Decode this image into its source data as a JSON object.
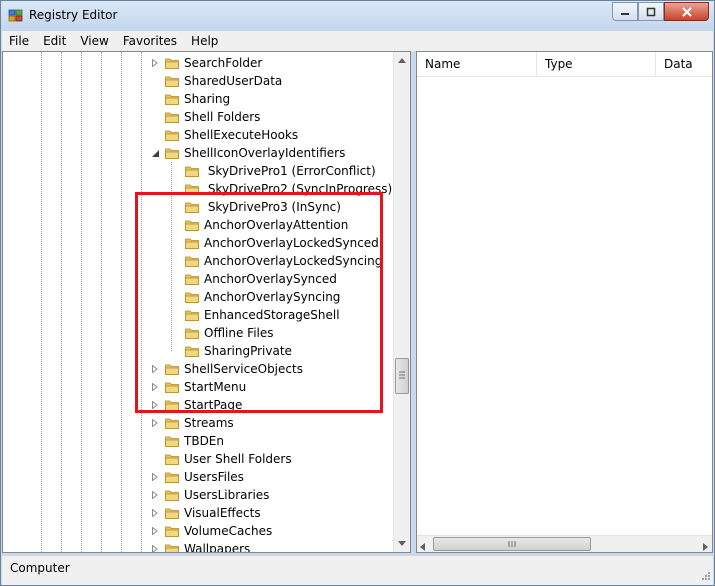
{
  "window": {
    "title": "Registry Editor",
    "app_icon": "registry-icon"
  },
  "menu": [
    "File",
    "Edit",
    "View",
    "Favorites",
    "Help"
  ],
  "tree": {
    "items": [
      {
        "label": "SearchFolder",
        "expander": "collapsed",
        "level": 0
      },
      {
        "label": "SharedUserData",
        "expander": "none",
        "level": 0
      },
      {
        "label": "Sharing",
        "expander": "none",
        "level": 0
      },
      {
        "label": "Shell Folders",
        "expander": "none",
        "level": 0
      },
      {
        "label": "ShellExecuteHooks",
        "expander": "none",
        "level": 0
      },
      {
        "label": "ShellIconOverlayIdentifiers",
        "expander": "expanded",
        "level": 0
      },
      {
        "label": " SkyDrivePro1 (ErrorConflict)",
        "expander": "none",
        "level": 1
      },
      {
        "label": " SkyDrivePro2 (SyncInProgress)",
        "expander": "none",
        "level": 1
      },
      {
        "label": " SkyDrivePro3 (InSync)",
        "expander": "none",
        "level": 1
      },
      {
        "label": "AnchorOverlayAttention",
        "expander": "none",
        "level": 1
      },
      {
        "label": "AnchorOverlayLockedSynced",
        "expander": "none",
        "level": 1
      },
      {
        "label": "AnchorOverlayLockedSyncing",
        "expander": "none",
        "level": 1
      },
      {
        "label": "AnchorOverlaySynced",
        "expander": "none",
        "level": 1
      },
      {
        "label": "AnchorOverlaySyncing",
        "expander": "none",
        "level": 1
      },
      {
        "label": "EnhancedStorageShell",
        "expander": "none",
        "level": 1
      },
      {
        "label": "Offline Files",
        "expander": "none",
        "level": 1
      },
      {
        "label": "SharingPrivate",
        "expander": "none",
        "level": 1
      },
      {
        "label": "ShellServiceObjects",
        "expander": "collapsed",
        "level": 0
      },
      {
        "label": "StartMenu",
        "expander": "collapsed",
        "level": 0
      },
      {
        "label": "StartPage",
        "expander": "collapsed",
        "level": 0
      },
      {
        "label": "Streams",
        "expander": "collapsed",
        "level": 0
      },
      {
        "label": "TBDEn",
        "expander": "none",
        "level": 0
      },
      {
        "label": "User Shell Folders",
        "expander": "none",
        "level": 0
      },
      {
        "label": "UsersFiles",
        "expander": "collapsed",
        "level": 0
      },
      {
        "label": "UsersLibraries",
        "expander": "collapsed",
        "level": 0
      },
      {
        "label": "VisualEffects",
        "expander": "collapsed",
        "level": 0
      },
      {
        "label": "VolumeCaches",
        "expander": "collapsed",
        "level": 0
      },
      {
        "label": "Wallpapers",
        "expander": "collapsed",
        "level": 0
      }
    ]
  },
  "list": {
    "columns": [
      "Name",
      "Type",
      "Data"
    ]
  },
  "status": {
    "path": "Computer"
  },
  "colors": {
    "highlight": "#e8141c",
    "folder": "#e8c25a"
  }
}
